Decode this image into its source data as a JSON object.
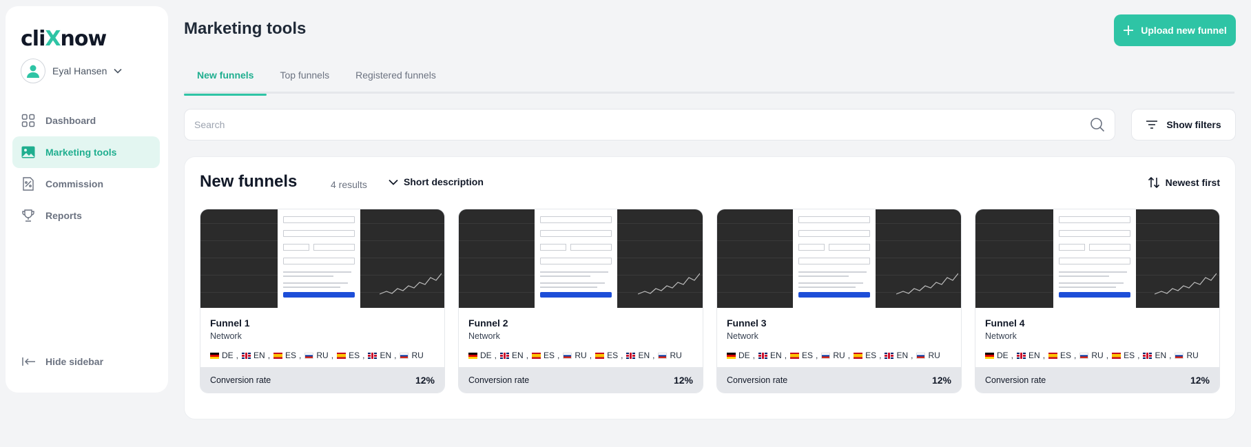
{
  "app": {
    "logo_pre": "cli",
    "logo_x": "X",
    "logo_post": "now"
  },
  "user": {
    "name": "Eyal Hansen"
  },
  "sidebar": {
    "items": [
      {
        "label": "Dashboard",
        "icon": "grid-icon"
      },
      {
        "label": "Marketing tools",
        "icon": "image-icon",
        "active": true
      },
      {
        "label": "Commission",
        "icon": "percent-doc-icon"
      },
      {
        "label": "Reports",
        "icon": "trophy-icon"
      }
    ],
    "hide_label": "Hide sidebar"
  },
  "header": {
    "title": "Marketing tools",
    "upload_label": "Upload new funnel"
  },
  "tabs": [
    {
      "label": "New funnels",
      "active": true
    },
    {
      "label": "Top funnels"
    },
    {
      "label": "Registered funnels"
    }
  ],
  "search": {
    "placeholder": "Search",
    "value": ""
  },
  "filters": {
    "label": "Show filters"
  },
  "panel": {
    "title": "New funnels",
    "results": "4 results",
    "view_label": "Short description",
    "sort_label": "Newest first"
  },
  "languages": [
    {
      "code": "DE",
      "sep": ","
    },
    {
      "code": "EN",
      "sep": ","
    },
    {
      "code": "ES",
      "sep": ","
    },
    {
      "code": "RU",
      "sep": ","
    },
    {
      "code": "ES",
      "sep": ","
    },
    {
      "code": "EN",
      "sep": ","
    },
    {
      "code": "RU",
      "sep": ""
    }
  ],
  "funnels": [
    {
      "name": "Funnel 1",
      "type": "Network",
      "conversion_label": "Conversion rate",
      "conversion": "12%"
    },
    {
      "name": "Funnel 2",
      "type": "Network",
      "conversion_label": "Conversion rate",
      "conversion": "12%"
    },
    {
      "name": "Funnel 3",
      "type": "Network",
      "conversion_label": "Conversion rate",
      "conversion": "12%"
    },
    {
      "name": "Funnel 4",
      "type": "Network",
      "conversion_label": "Conversion rate",
      "conversion": "12%"
    }
  ],
  "colors": {
    "accent": "#2ec4a5",
    "accent_dark": "#1fae8f",
    "accent_soft": "#e3f6f1"
  }
}
